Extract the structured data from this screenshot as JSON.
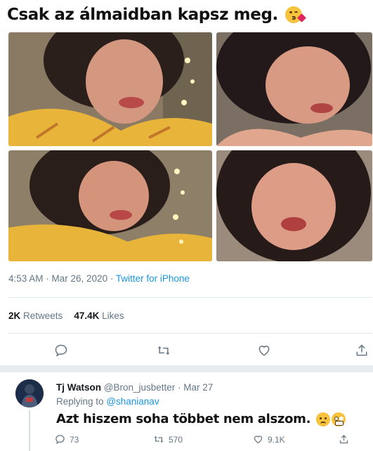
{
  "caption": {
    "text": "Csak az álmaidban kapsz meg.",
    "emoji": "face-blowing-kiss-icon"
  },
  "tweet": {
    "timestamp": "4:53 AM · Mar 26, 2020 ·",
    "source": "Twitter for iPhone",
    "retweets_count": "2K",
    "retweets_label": "Retweets",
    "likes_count": "47.4K",
    "likes_label": "Likes",
    "actions": [
      "reply-icon",
      "retweet-icon",
      "like-icon",
      "share-icon"
    ]
  },
  "reply": {
    "name": "Tj Watson",
    "handle": "@Bron_jusbetter",
    "date": "· Mar 27",
    "replying_prefix": "Replying to",
    "replying_handle": "@shanianav",
    "text": "Azt hiszem soha többet nem alszom.",
    "emojis": [
      "frowning-face-icon",
      "grimacing-face-icon"
    ],
    "reply_count": "73",
    "retweet_count": "570",
    "like_count": "9.1K"
  },
  "colors": {
    "link": "#1b95e0",
    "muted": "#657786",
    "text": "#14171a",
    "divider": "#e1e8ed",
    "shirt": "#e8b53a"
  }
}
